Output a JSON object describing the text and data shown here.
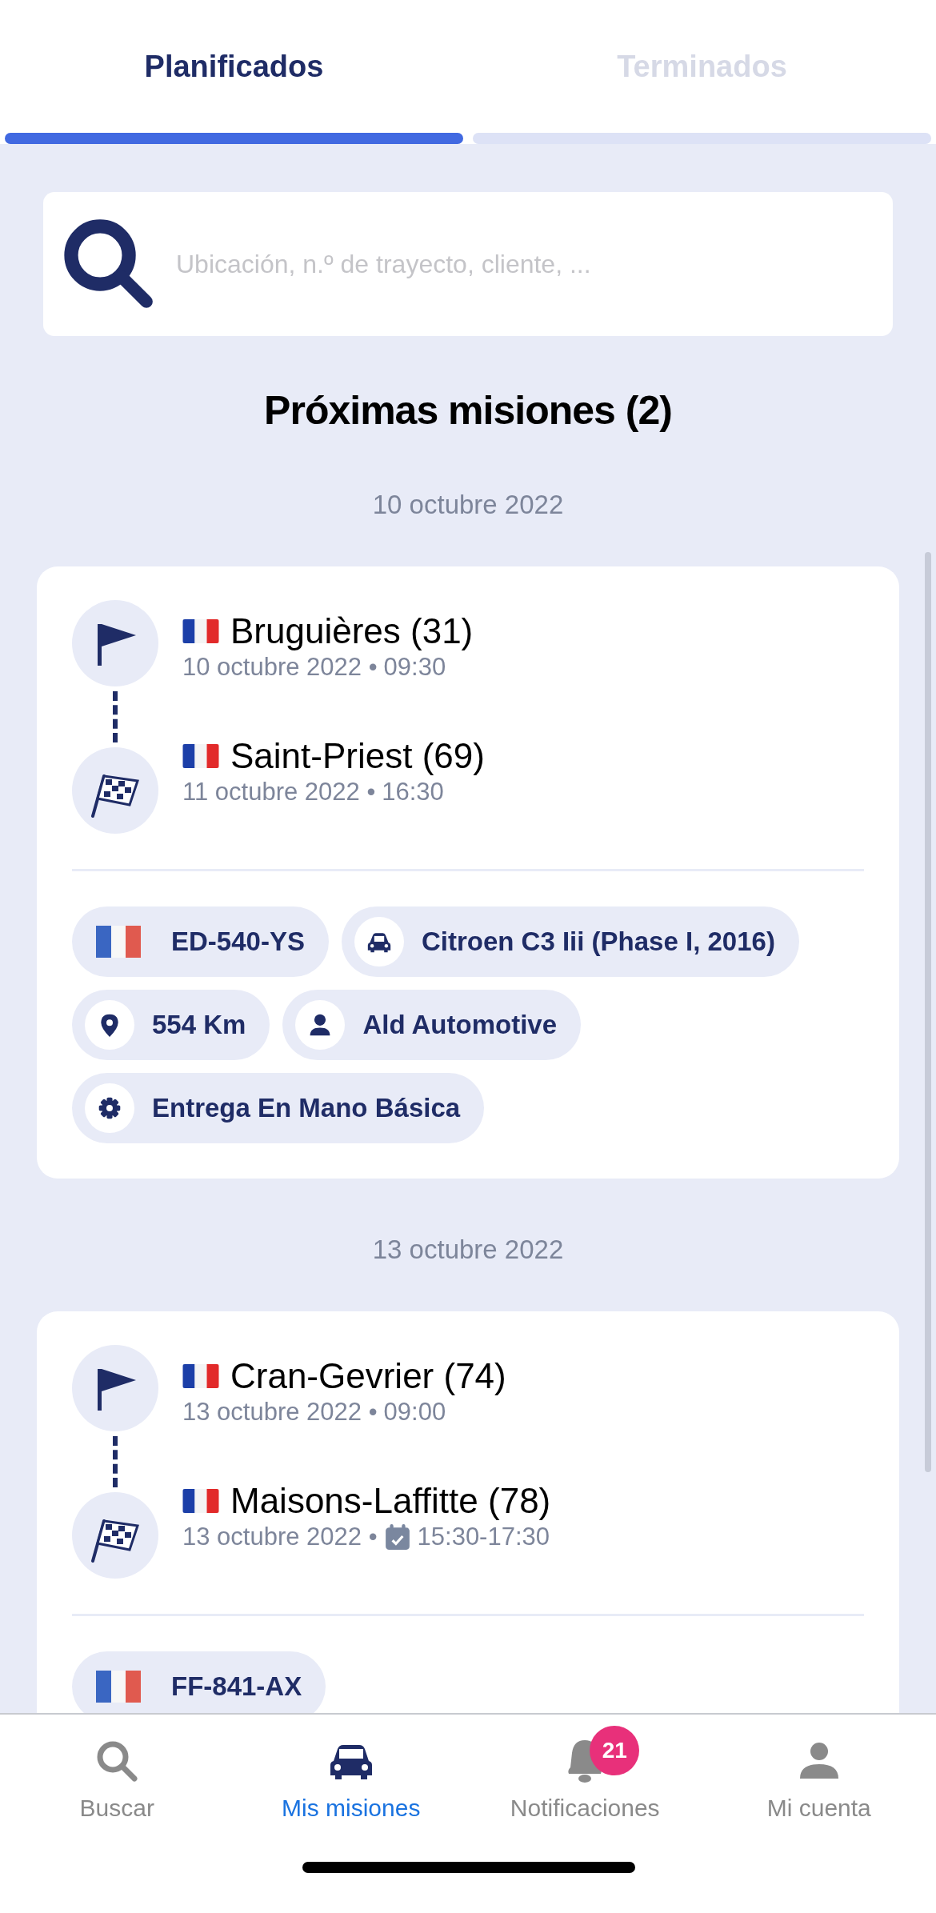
{
  "tabs": [
    {
      "label": "Planificados",
      "selected": true
    },
    {
      "label": "Terminados",
      "selected": false
    }
  ],
  "search": {
    "placeholder": "Ubicación, n.º de trayecto, cliente, ..."
  },
  "title": "Próximas misiones (2)",
  "groups": [
    {
      "date": "10 octubre 2022",
      "missions": [
        {
          "stops": [
            {
              "kind": "start",
              "place": "Bruguières (31)",
              "date": "10 octubre 2022 •",
              "time": "09:30",
              "slot": false
            },
            {
              "kind": "end",
              "place": "Saint-Priest (69)",
              "date": "11 octubre 2022 •",
              "time": "16:30",
              "slot": false
            }
          ],
          "tags": [
            {
              "kind": "plate",
              "label": "ED-540-YS"
            },
            {
              "kind": "car",
              "label": "Citroen C3 Iii (Phase I, 2016)"
            },
            {
              "kind": "distance",
              "label": "554 Km"
            },
            {
              "kind": "client",
              "label": "Ald Automotive"
            },
            {
              "kind": "service",
              "label": "Entrega En Mano Básica"
            }
          ]
        }
      ]
    },
    {
      "date": "13 octubre 2022",
      "missions": [
        {
          "stops": [
            {
              "kind": "start",
              "place": "Cran-Gevrier (74)",
              "date": "13 octubre 2022 •",
              "time": "09:00",
              "slot": false
            },
            {
              "kind": "end",
              "place": "Maisons-Laffitte (78)",
              "date": "13 octubre 2022 •",
              "time": "15:30-17:30",
              "slot": true
            }
          ],
          "tags": [
            {
              "kind": "plate",
              "label": "FF-841-AX"
            }
          ]
        }
      ]
    }
  ],
  "nav": [
    {
      "kind": "search",
      "label": "Buscar",
      "selected": false
    },
    {
      "kind": "car",
      "label": "Mis misiones",
      "selected": true
    },
    {
      "kind": "bell",
      "label": "Notificaciones",
      "selected": false,
      "badge": "21"
    },
    {
      "kind": "person",
      "label": "Mi cuenta",
      "selected": false
    }
  ]
}
